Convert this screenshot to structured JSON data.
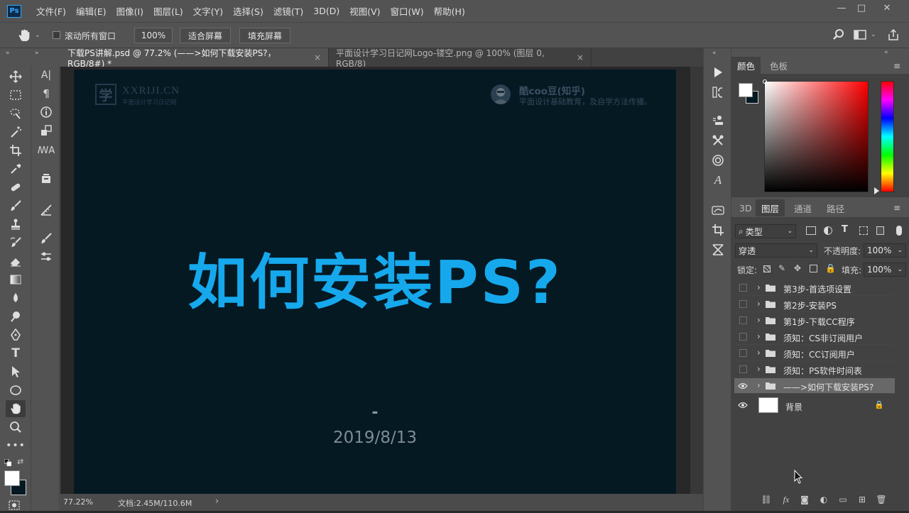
{
  "menubar": {
    "logo": "Ps",
    "items": [
      "文件(F)",
      "编辑(E)",
      "图像(I)",
      "图层(L)",
      "文字(Y)",
      "选择(S)",
      "滤镜(T)",
      "3D(D)",
      "视图(V)",
      "窗口(W)",
      "帮助(H)"
    ],
    "window_controls": {
      "minimize": "—",
      "restore": "□",
      "close": "✕"
    }
  },
  "options": {
    "scroll_all_windows_label": "滚动所有窗口",
    "scroll_all_windows_checked": false,
    "zoom_value": "100%",
    "fit_screen_label": "适合屏幕",
    "fill_screen_label": "填充屏幕"
  },
  "tabs": [
    {
      "label": "下载PS讲解.psd @ 77.2% (——>如何下载安装PS?，RGB/8#) *",
      "active": true
    },
    {
      "label": "平面设计学习日记网Logo-镂空.png @ 100% (图层 0, RGB/8)",
      "active": false
    }
  ],
  "tab_close": "×",
  "artboard": {
    "logo_mark": "学",
    "logo_text": "XXRIJI.CN",
    "logo_sub": "平面设计学习日记网",
    "author_name": "酷coo豆(知乎)",
    "author_desc": "平面设计基础教育，及自学方法传播。",
    "headline": "如何安装PS?",
    "dash": "-",
    "date": "2019/8/13"
  },
  "status": {
    "zoom": "77.22%",
    "doc": "文档:2.45M/110.6M",
    "arrow": "›"
  },
  "right_panels": {
    "color_tabs": [
      "颜色",
      "色板"
    ],
    "layer_tabs": [
      "3D",
      "图层",
      "通道",
      "路径"
    ],
    "filter_kind": "类型",
    "blend_mode": "穿透",
    "opacity_label": "不透明度:",
    "opacity_value": "100%",
    "lock_label": "锁定:",
    "fill_label": "填充:",
    "fill_value": "100%"
  },
  "layers": [
    {
      "name": "第3步-首选项设置",
      "visible": false,
      "group": true,
      "selected": false
    },
    {
      "name": "第2步-安装PS",
      "visible": false,
      "group": true,
      "selected": false
    },
    {
      "name": "第1步-下载CC程序",
      "visible": false,
      "group": true,
      "selected": false
    },
    {
      "name": "须知：CS非订阅用户",
      "visible": false,
      "group": true,
      "selected": false
    },
    {
      "name": "须知：CC订阅用户",
      "visible": false,
      "group": true,
      "selected": false
    },
    {
      "name": "须知：PS软件时间表",
      "visible": false,
      "group": true,
      "selected": false
    },
    {
      "name": "——>如何下载安装PS?",
      "visible": true,
      "group": true,
      "selected": true
    }
  ],
  "background_layer": {
    "name": "背景",
    "visible": true,
    "locked": true
  },
  "colors": {
    "accent_blue": "#16a8ec",
    "canvas_bg": "#051923",
    "ui_bg": "#535353",
    "foreground": "#ffffff",
    "background": "#051923"
  }
}
